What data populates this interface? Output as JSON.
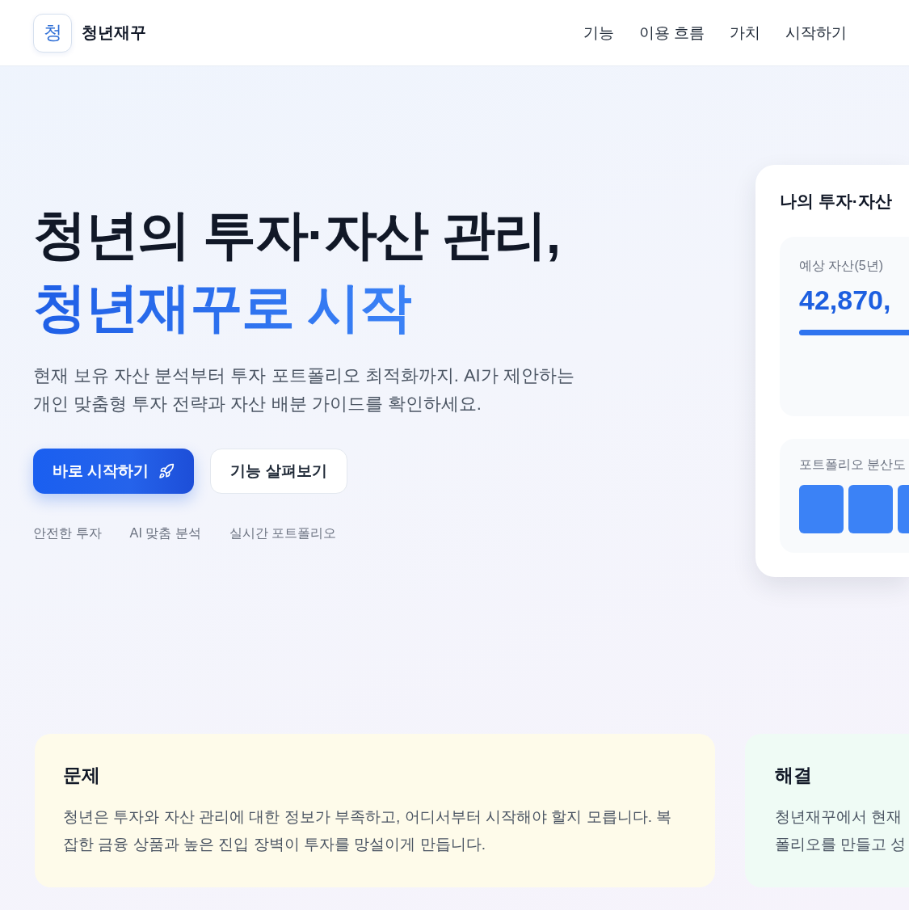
{
  "header": {
    "logo_mark": "청",
    "brand": "청년재꾸",
    "nav": [
      "기능",
      "이용 흐름",
      "가치",
      "시작하기"
    ]
  },
  "hero": {
    "title_line_1": "청년의 투자·자산 관리,",
    "title_line_2": "청년재꾸로 시작",
    "description": "현재 보유 자산 분석부터 투자 포트폴리오 최적화까지. AI가 제안하는 개인 맞춤형 투자 전략과 자산 배분 가이드를 확인하세요.",
    "buttons": [
      {
        "label": "바로 시작하기",
        "kind": "primary"
      },
      {
        "label": "기능 살펴보기",
        "kind": "secondary"
      }
    ],
    "highlights": [
      "안전한 투자",
      "AI 맞춤 분석",
      "실시간 포트폴리오"
    ]
  },
  "dashboard": {
    "title": "나의 투자·자산",
    "projected": {
      "label": "예상 자산(5년)",
      "value": "42,870,",
      "level": 1
    },
    "diversification": {
      "label": "포트폴리오 분산도"
    }
  },
  "cards": [
    {
      "kind": "problem",
      "title": "문제",
      "lines": [
        "청년은 투자와 자산 관리에 대한 정보가 부족하고, 어디서부터 시작해야 할지 모릅니다. 복잡한 금융 상품과 높은 진입 장벽이 투자를 망설이게 만듭니다."
      ]
    },
    {
      "kind": "solution",
      "title": "해결",
      "lines": [
        "청년재꾸에서 현재",
        "폴리오를 만들고 성"
      ]
    }
  ]
}
